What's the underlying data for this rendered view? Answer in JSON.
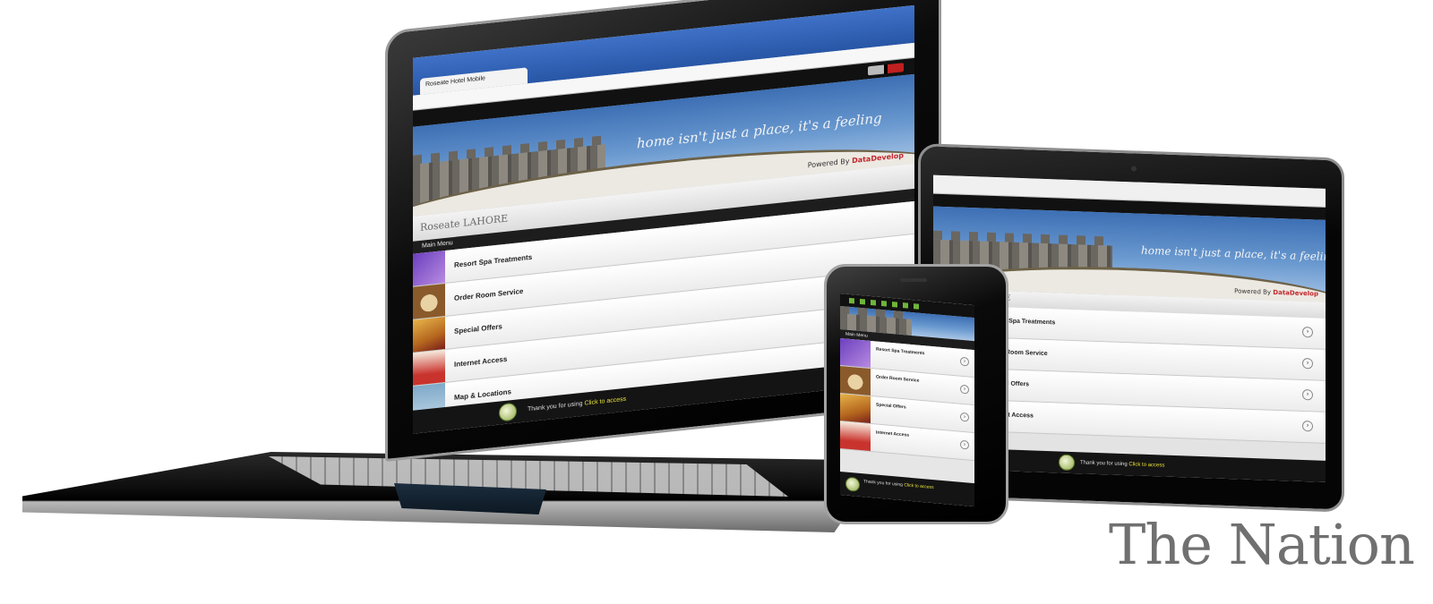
{
  "watermark": "The Nation",
  "site": {
    "tagline": "home isn't just a place, it's a feeling",
    "powered_by": "Powered By",
    "powered_brand": "DataDevelop",
    "logo": "Roseate LAHORE",
    "menu_title": "Main Menu",
    "menu_items": [
      "Resort Spa Treatments",
      "Order Room Service",
      "Special Offers",
      "Internet Access",
      "Map & Locations"
    ],
    "footer_text": "Thank you for using ",
    "footer_link": "Click to access"
  },
  "laptop": {
    "tab_title": "Roseate Hotel Mobile"
  },
  "colors": {
    "sky": "#4f7fc0",
    "footer_link": "#e8e23a",
    "brand_red": "#c3272d",
    "watermark": "#707070"
  },
  "icons": [
    "arrow-right-icon",
    "badge-icon"
  ]
}
